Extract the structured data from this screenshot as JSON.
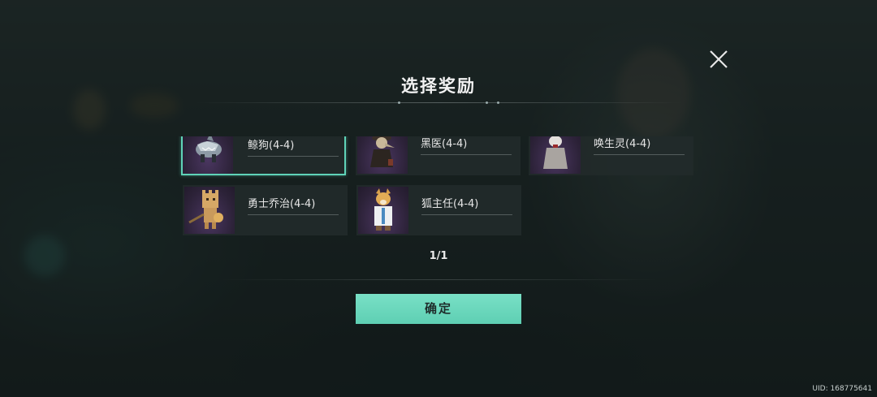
{
  "dialog": {
    "title": "选择奖励",
    "page_indicator": "1/1",
    "confirm_label": "确定"
  },
  "rewards": [
    {
      "name": "鲸狗(4-4)",
      "selected": true,
      "icon": "shark-dog-figure"
    },
    {
      "name": "黑医(4-4)",
      "selected": false,
      "icon": "plague-doctor-figure"
    },
    {
      "name": "唤生灵(4-4)",
      "selected": false,
      "icon": "wolf-spirit-figure"
    },
    {
      "name": "勇士乔治(4-4)",
      "selected": false,
      "icon": "cardboard-knight-figure"
    },
    {
      "name": "狐主任(4-4)",
      "selected": false,
      "icon": "fox-doctor-figure"
    }
  ],
  "footer": {
    "uid": "UID: 168775641"
  },
  "colors": {
    "accent": "#5fd3b8",
    "confirm_bg": "#6dd8be",
    "card_bg": "#222a2a"
  }
}
